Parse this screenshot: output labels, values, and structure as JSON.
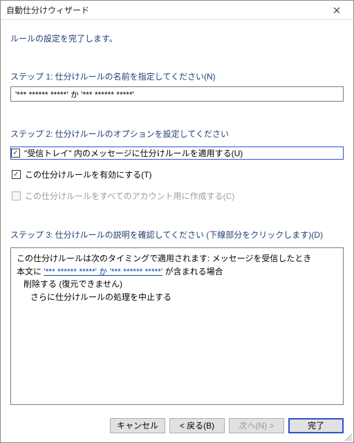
{
  "window": {
    "title": "自動仕分けウィザード"
  },
  "intro": "ルールの設定を完了します。",
  "step1": {
    "label": "ステップ 1: 仕分けルールの名前を指定してください(N)",
    "value": "'*** ****** *****' か '*** ****** *****'"
  },
  "step2": {
    "label": "ステップ 2: 仕分けルールのオプションを設定してください",
    "opt_apply": {
      "checked": true,
      "label": "\"受信トレイ\" 内のメッセージに仕分けルールを適用する(U)"
    },
    "opt_enable": {
      "checked": true,
      "label": "この仕分けルールを有効にする(T)"
    },
    "opt_all": {
      "checked": false,
      "label": "この仕分けルールをすべてのアカウント用に作成する(C)",
      "disabled": true
    }
  },
  "step3": {
    "label": "ステップ 3: 仕分けルールの説明を確認してください (下線部分をクリックします)(D)",
    "line1": "この仕分けルールは次のタイミングで適用されます: メッセージを受信したとき",
    "line2_pre": "本文に ",
    "line2_link": "'*** ****** *****' か '*** ****** *****'",
    "line2_post": " が含まれる場合",
    "line3": "削除する (復元できません)",
    "line4": "さらに仕分けルールの処理を中止する"
  },
  "buttons": {
    "cancel": "キャンセル",
    "back": "< 戻る(B)",
    "next": "次へ(N) >",
    "finish": "完了"
  }
}
